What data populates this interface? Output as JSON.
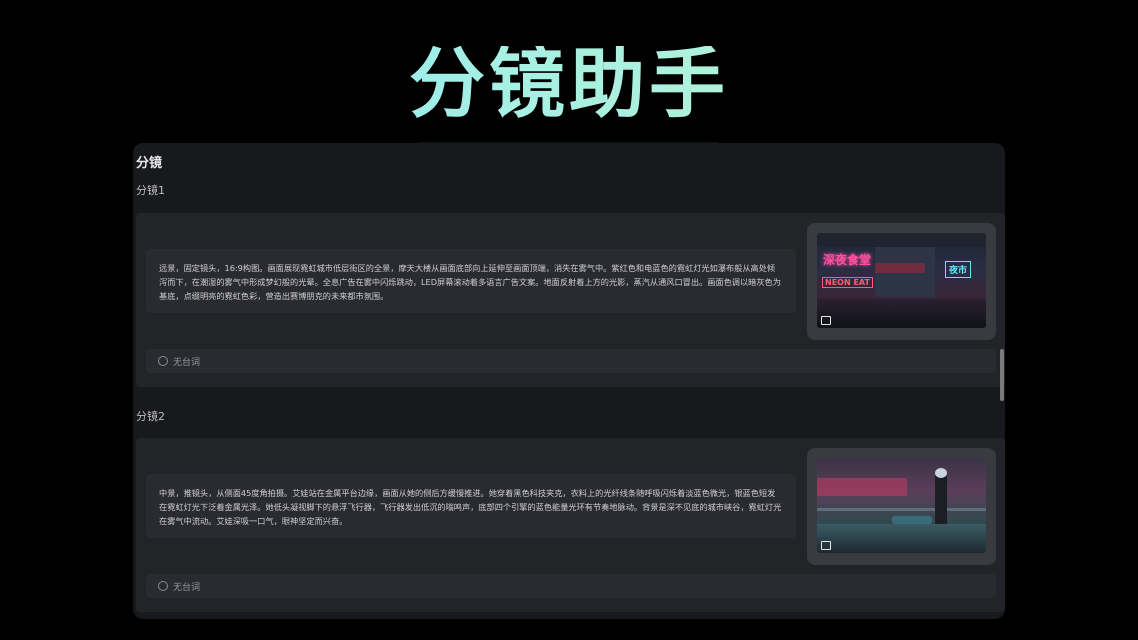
{
  "app": {
    "title": "分镜助手"
  },
  "panel": {
    "heading": "分镜",
    "shots": [
      {
        "label": "分镜1",
        "description": "远景，固定镜头，16:9构图。画面展现霓虹城市低层街区的全景，摩天大楼从画面底部向上延伸至画面顶端，消失在雾气中。紫红色和电蓝色的霓虹灯光如瀑布般从高处倾泻而下，在潮湿的雾气中形成梦幻般的光晕。全息广告在雾中闪烁跳动，LED屏幕滚动着多语言广告文案。地面反射着上方的光影，蒸汽从通风口冒出。画面色调以暗灰色为基底，点缀明亮的霓虹色彩，营造出赛博朋克的未来都市氛围。",
        "dialogue": "无台词",
        "image_icon": "image-icon",
        "neon_signs": [
          "深夜食堂",
          "NEON EAT",
          "夜市"
        ]
      },
      {
        "label": "分镜2",
        "description": "中景，推镜头，从侧面45度角拍摄。艾娃站在金属平台边缘，画面从她的侧后方缓慢推进。她穿着黑色科技夹克，衣料上的光纤线条随呼吸闪烁着淡蓝色微光，银蓝色短发在霓虹灯光下泛着金属光泽。她低头凝视脚下的悬浮飞行器，飞行器发出低沉的嗡鸣声，底部四个引擎的蓝色能量光环有节奏地脉动。背景是深不见底的城市峡谷，霓虹灯光在雾气中流动。艾娃深吸一口气，眼神坚定而兴奋。",
        "dialogue": "无台词",
        "image_icon": "image-icon"
      }
    ]
  },
  "icons": {
    "dialogue": "speech-icon"
  },
  "colors": {
    "background": "#000000",
    "panel": "#18191c",
    "card": "#232428",
    "title_start": "#7ee2ff",
    "title_end": "#bff3c9"
  }
}
